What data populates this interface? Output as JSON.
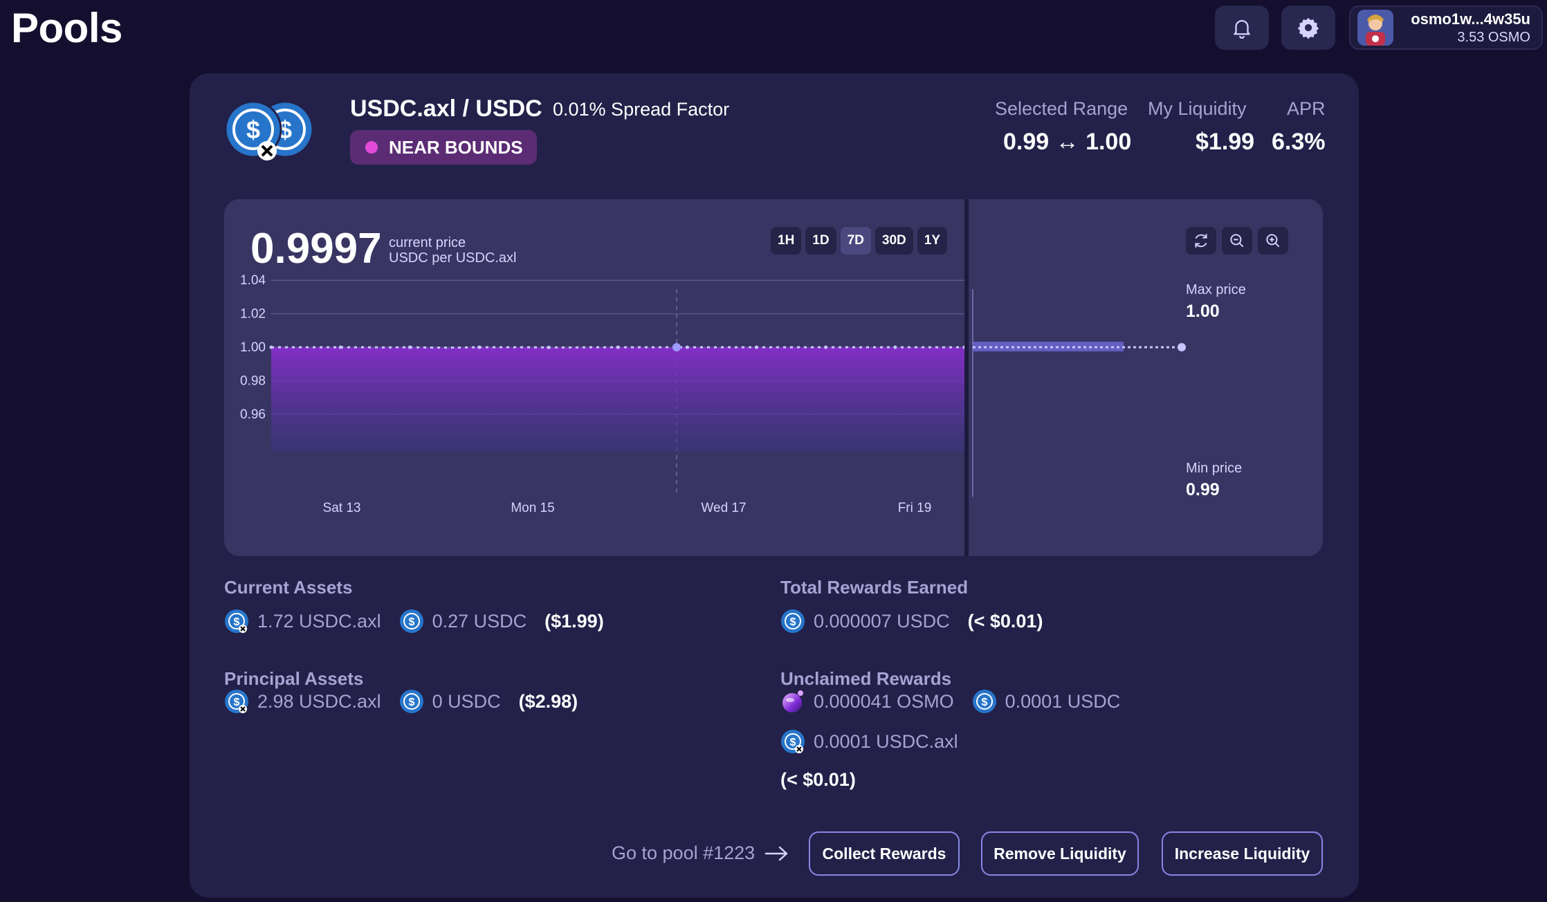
{
  "header": {
    "title": "Pools",
    "wallet": {
      "address": "osmo1w...4w35u",
      "balance": "3.53 OSMO"
    },
    "icons": {
      "notifications": "bell-icon",
      "settings": "gear-icon"
    }
  },
  "position": {
    "pair": "USDC.axl / USDC",
    "spread_factor": "0.01% Spread Factor",
    "status": "NEAR BOUNDS",
    "stats": {
      "selected_range_label": "Selected Range",
      "selected_range_value": "0.99 ↔ 1.00",
      "my_liquidity_label": "My Liquidity",
      "my_liquidity_value": "$1.99",
      "apr_label": "APR",
      "apr_value": "6.3%"
    }
  },
  "price_panel": {
    "current_price": "0.9997",
    "current_price_label": "current price",
    "price_unit": "USDC per USDC.axl",
    "timeframes": [
      "1H",
      "1D",
      "7D",
      "30D",
      "1Y"
    ],
    "active_timeframe": "7D",
    "max_price_label": "Max price",
    "max_price": "1.00",
    "min_price_label": "Min price",
    "min_price": "0.99",
    "zoom_icons": [
      "refresh-icon",
      "zoom-out-icon",
      "zoom-in-icon"
    ]
  },
  "chart_data": {
    "type": "area",
    "title": "",
    "xlabel": "",
    "ylabel": "",
    "x_ticks": [
      "Sat 13",
      "Mon 15",
      "Wed 17",
      "Fri 19"
    ],
    "y_ticks": [
      "1.04",
      "1.02",
      "1.00",
      "0.98",
      "0.96"
    ],
    "ylim": [
      0.95,
      1.05
    ],
    "grid": true,
    "series": [
      {
        "values": [
          1.0,
          1.0,
          1.0,
          1.0,
          1.0,
          0.9999,
          1.0,
          0.9998,
          0.9998,
          1.0,
          1.0,
          1.0,
          0.9999,
          0.9999,
          1.0,
          1.0,
          1.0,
          1.0,
          1.0,
          1.0,
          1.0,
          1.0,
          1.0,
          1.0,
          1.0,
          1.0,
          1.0,
          1.0,
          1.0,
          1.0,
          1.0
        ],
        "color": "#a3a0ff"
      }
    ],
    "range_bar": {
      "min": 0.99,
      "max": 1.0
    },
    "colors": {
      "fill_top": "#8a2fd0",
      "fill_bottom": "#3a3580",
      "line": "#c9c6ff"
    }
  },
  "assets": {
    "current_label": "Current Assets",
    "current": [
      {
        "text": "1.72 USDC.axl",
        "icon": "usdc-axl-icon"
      },
      {
        "text": "0.27 USDC",
        "icon": "usdc-icon"
      }
    ],
    "current_usd": "($1.99)",
    "principal_label": "Principal Assets",
    "principal": [
      {
        "text": "2.98 USDC.axl",
        "icon": "usdc-axl-icon"
      },
      {
        "text": "0 USDC",
        "icon": "usdc-icon"
      }
    ],
    "principal_usd": "($2.98)"
  },
  "rewards": {
    "total_label": "Total Rewards Earned",
    "total": {
      "text": "0.000007 USDC",
      "icon": "usdc-icon"
    },
    "total_usd": "(< $0.01)",
    "unclaimed_label": "Unclaimed Rewards",
    "unclaimed": [
      {
        "text": "0.000041 OSMO",
        "icon": "osmo-icon"
      },
      {
        "text": "0.0001 USDC",
        "icon": "usdc-icon"
      },
      {
        "text": "0.0001 USDC.axl",
        "icon": "usdc-axl-icon"
      }
    ],
    "unclaimed_usd": "(< $0.01)"
  },
  "actions": {
    "goto_pool": "Go to pool #1223",
    "collect": "Collect Rewards",
    "remove": "Remove Liquidity",
    "increase": "Increase Liquidity"
  }
}
